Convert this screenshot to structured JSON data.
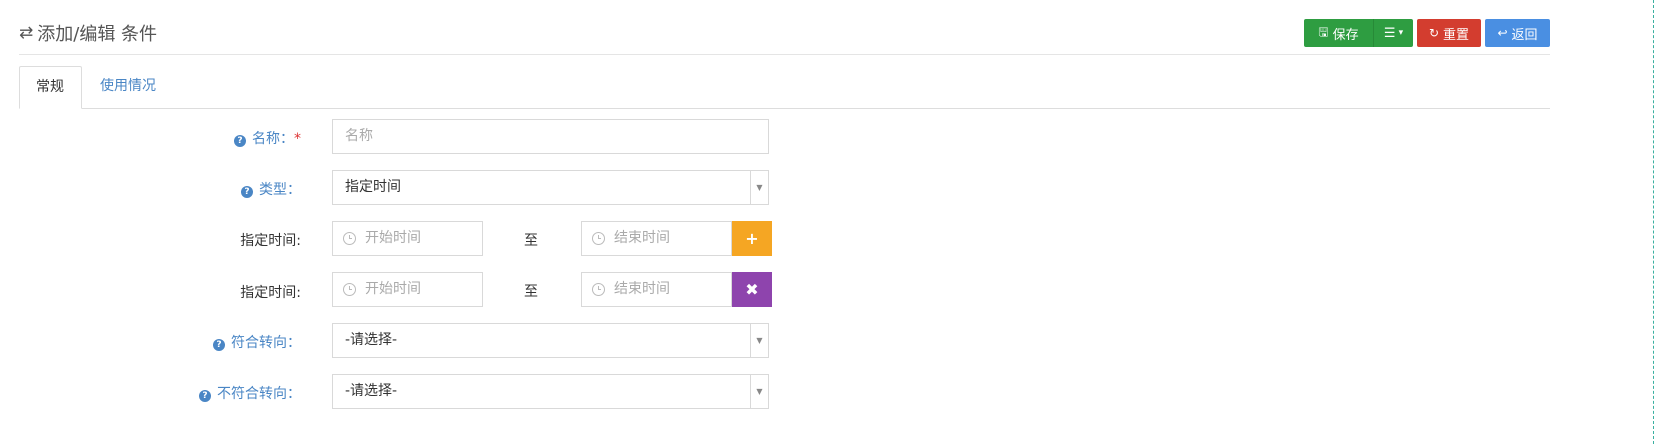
{
  "header": {
    "title": "添加/编辑 条件",
    "buttons": {
      "save": "保存",
      "reset": "重置",
      "back": "返回"
    }
  },
  "tabs": [
    {
      "label": "常规",
      "active": true
    },
    {
      "label": "使用情况",
      "active": false
    }
  ],
  "form": {
    "name": {
      "label": "名称：",
      "placeholder": "名称",
      "value": "",
      "required_mark": "*"
    },
    "type": {
      "label": "类型：",
      "value": "指定时间"
    },
    "time_rows": [
      {
        "label": "指定时间:",
        "start_placeholder": "开始时间",
        "to": "至",
        "end_placeholder": "结束时间",
        "action": "add"
      },
      {
        "label": "指定时间:",
        "start_placeholder": "开始时间",
        "to": "至",
        "end_placeholder": "结束时间",
        "action": "remove"
      }
    ],
    "match_redirect": {
      "label": "符合转向：",
      "value": "-请选择-"
    },
    "nomatch_redirect": {
      "label": "不符合转向：",
      "value": "-请选择-"
    }
  },
  "colors": {
    "save": "#2e9d41",
    "reset": "#d33d2f",
    "back": "#4a8fe2",
    "add": "#f5a623",
    "remove": "#8e44ad",
    "label_blue": "#4a86c5"
  }
}
